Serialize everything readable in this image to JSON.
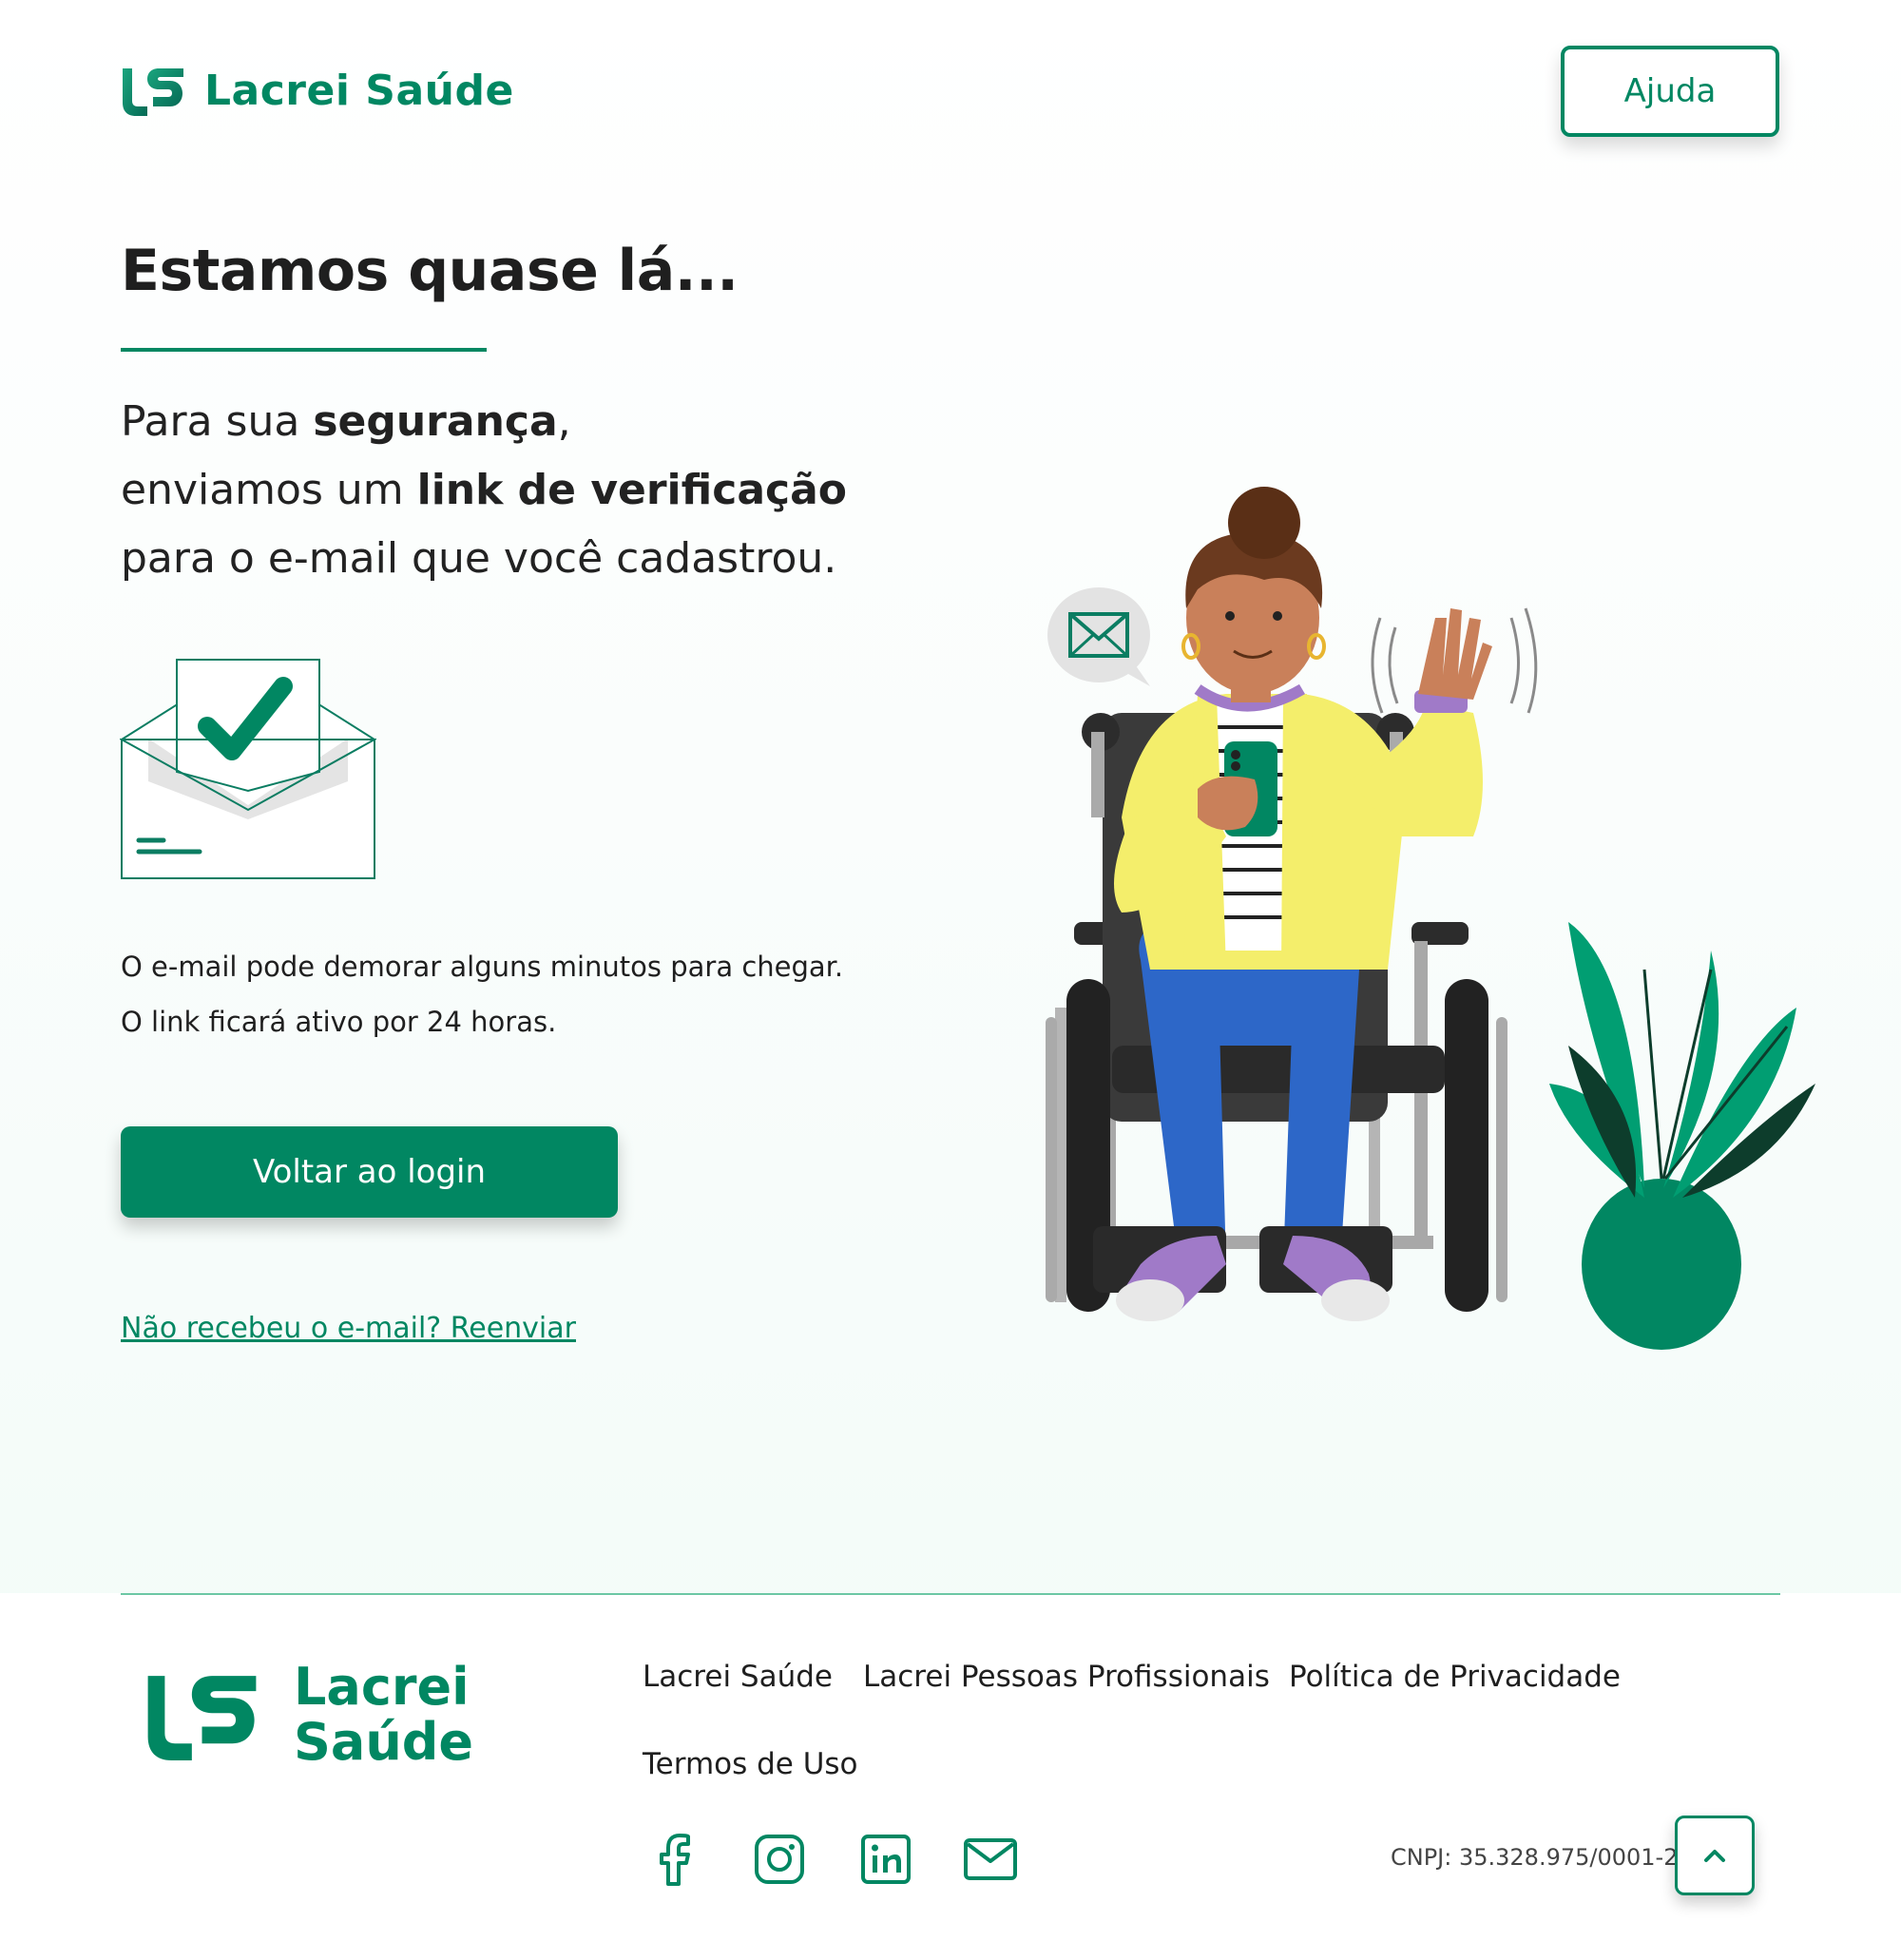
{
  "header": {
    "brand_name": "Lacrei Saúde",
    "help_label": "Ajuda"
  },
  "main": {
    "title": "Estamos quase lá...",
    "lead_line1_prefix": "Para sua ",
    "lead_line1_bold": "segurança",
    "lead_line1_suffix": ",",
    "lead_line2_prefix": "enviamos um ",
    "lead_line2_bold": "link de verificação",
    "lead_line3": "para o e-mail que você cadastrou.",
    "note_line1": "O e-mail pode demorar alguns minutos para chegar.",
    "note_line2": "O link ficará ativo por 24 horas.",
    "login_button": "Voltar ao login",
    "resend_link": "Não recebeu o e-mail? Reenviar"
  },
  "footer": {
    "brand_line1": "Lacrei",
    "brand_line2": "Saúde",
    "links": [
      "Lacrei Saúde",
      "Lacrei Pessoas Profissionais",
      "Política de Privacidade",
      "Termos de Uso"
    ],
    "social": [
      "facebook-icon",
      "instagram-icon",
      "linkedin-icon",
      "email-icon"
    ],
    "cnpj": "CNPJ: 35.328.975/0001-28"
  },
  "colors": {
    "brand": "#018762",
    "brand_dark": "#0b6b55",
    "text": "#1f1f1f"
  }
}
